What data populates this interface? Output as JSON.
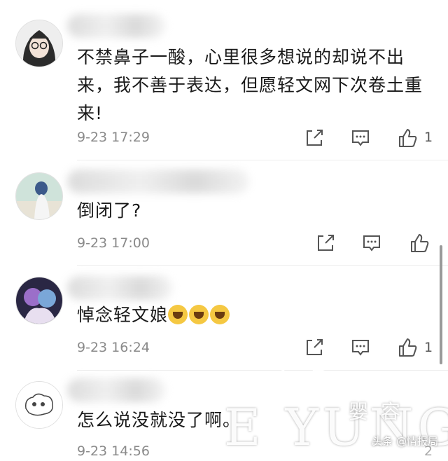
{
  "comments": [
    {
      "text": "不禁鼻子一酸，心里很多想说的却说不出来，我不善于表达，但愿轻文网下次卷土重来!",
      "time": "9-23 17:29",
      "likes": "1"
    },
    {
      "text": "倒闭了?",
      "time": "9-23 17:00",
      "likes": ""
    },
    {
      "text": "悼念轻文娘",
      "emoji_count": 3,
      "time": "9-23 16:24",
      "likes": "1"
    },
    {
      "text": "怎么说没就没了啊。",
      "time": "9-23 14:56",
      "likes": "2"
    }
  ],
  "icons": {
    "share": "share-icon",
    "reply": "comment-icon",
    "like": "thumbs-up-icon"
  },
  "watermark": {
    "big_letters": "E YUNG",
    "chinese": "婴容",
    "source": "头条 @情报局"
  },
  "colors": {
    "time": "#8a8a8a",
    "text": "#1a1a1a",
    "icon": "#555555"
  }
}
